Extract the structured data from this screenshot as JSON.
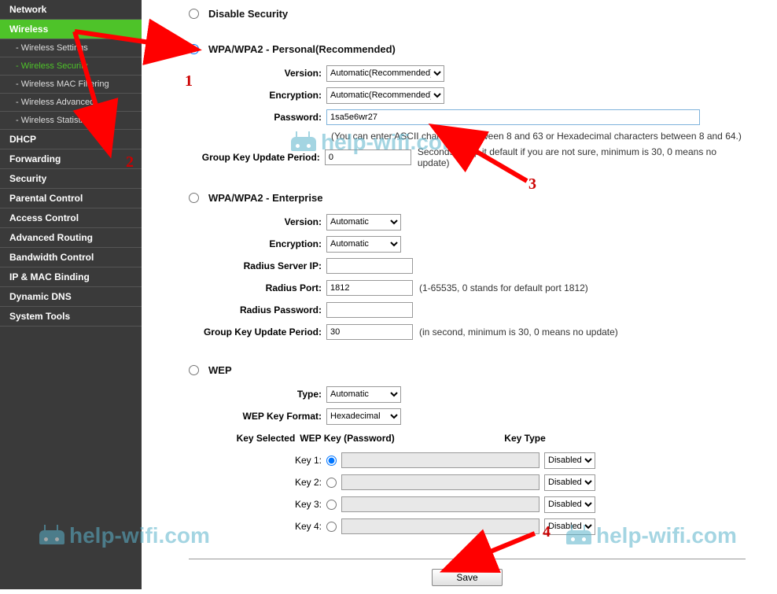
{
  "sidebar": {
    "items": [
      {
        "label": "Network",
        "cls": "nav-item"
      },
      {
        "label": "Wireless",
        "cls": "nav-item active"
      },
      {
        "label": "- Wireless Settings",
        "cls": "nav-item nav-sub"
      },
      {
        "label": "- Wireless Security",
        "cls": "nav-item nav-sub active-sub"
      },
      {
        "label": "- Wireless MAC Filtering",
        "cls": "nav-item nav-sub"
      },
      {
        "label": "- Wireless Advanced",
        "cls": "nav-item nav-sub"
      },
      {
        "label": "- Wireless Statistics",
        "cls": "nav-item nav-sub"
      },
      {
        "label": "DHCP",
        "cls": "nav-item"
      },
      {
        "label": "Forwarding",
        "cls": "nav-item"
      },
      {
        "label": "Security",
        "cls": "nav-item"
      },
      {
        "label": "Parental Control",
        "cls": "nav-item"
      },
      {
        "label": "Access Control",
        "cls": "nav-item"
      },
      {
        "label": "Advanced Routing",
        "cls": "nav-item"
      },
      {
        "label": "Bandwidth Control",
        "cls": "nav-item"
      },
      {
        "label": "IP & MAC Binding",
        "cls": "nav-item"
      },
      {
        "label": "Dynamic DNS",
        "cls": "nav-item"
      },
      {
        "label": "System Tools",
        "cls": "nav-item"
      }
    ]
  },
  "sections": {
    "disable": {
      "label": "Disable Security"
    },
    "personal": {
      "label": "WPA/WPA2 - Personal(Recommended)",
      "version_label": "Version:",
      "version_value": "Automatic(Recommended)",
      "encryption_label": "Encryption:",
      "encryption_value": "Automatic(Recommended)",
      "password_label": "Password:",
      "password_value": "1sa5e6wr27",
      "password_hint": "(You can enter ASCII characters between 8 and 63 or Hexadecimal characters between 8 and 64.)",
      "group_key_label": "Group Key Update Period:",
      "group_key_value": "0",
      "group_key_hint": "Seconds(Keep it default if you are not sure, minimum is 30, 0 means no update)"
    },
    "enterprise": {
      "label": "WPA/WPA2 - Enterprise",
      "version_label": "Version:",
      "version_value": "Automatic",
      "encryption_label": "Encryption:",
      "encryption_value": "Automatic",
      "radius_ip_label": "Radius Server IP:",
      "radius_ip_value": "",
      "radius_port_label": "Radius Port:",
      "radius_port_value": "1812",
      "radius_port_hint": "(1-65535, 0 stands for default port 1812)",
      "radius_pwd_label": "Radius Password:",
      "radius_pwd_value": "",
      "group_key_label": "Group Key Update Period:",
      "group_key_value": "30",
      "group_key_hint": "(in second, minimum is 30, 0 means no update)"
    },
    "wep": {
      "label": "WEP",
      "type_label": "Type:",
      "type_value": "Automatic",
      "format_label": "WEP Key Format:",
      "format_value": "Hexadecimal",
      "key_selected_label": "Key Selected",
      "wep_key_header": "WEP Key (Password)",
      "key_type_header": "Key Type",
      "keys": [
        {
          "label": "Key 1:",
          "value": "",
          "type": "Disabled"
        },
        {
          "label": "Key 2:",
          "value": "",
          "type": "Disabled"
        },
        {
          "label": "Key 3:",
          "value": "",
          "type": "Disabled"
        },
        {
          "label": "Key 4:",
          "value": "",
          "type": "Disabled"
        }
      ]
    }
  },
  "save_label": "Save",
  "watermark_text": "help-wifi.com",
  "annotations": {
    "n1": "1",
    "n2": "2",
    "n3": "3",
    "n4": "4"
  }
}
